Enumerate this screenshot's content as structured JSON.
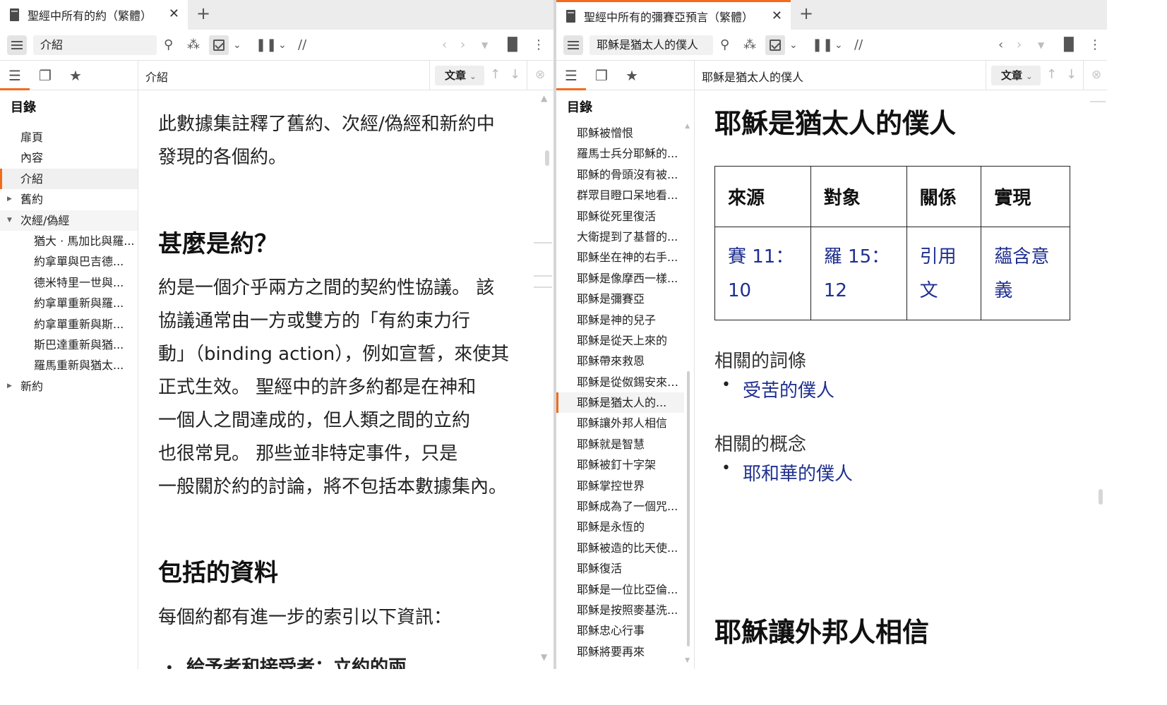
{
  "left": {
    "tab_title": "聖經中所有的約（繁體）",
    "toolbar_input": "介紹",
    "content_header_title": "介紹",
    "view_select": "文章",
    "toc_heading": "目錄",
    "toc": [
      {
        "label": "扉頁",
        "level": 0
      },
      {
        "label": "內容",
        "level": 0
      },
      {
        "label": "介紹",
        "level": 0,
        "selected": true
      },
      {
        "label": "舊約",
        "level": 0,
        "collapsed": true
      },
      {
        "label": "次經/偽經",
        "level": 0,
        "expanded": true
      },
      {
        "label": "猶大 · 馬加比與羅...",
        "level": 1
      },
      {
        "label": "約拿單與巴吉德...",
        "level": 1
      },
      {
        "label": "德米特里一世與...",
        "level": 1
      },
      {
        "label": "約拿單重新與羅...",
        "level": 1
      },
      {
        "label": "約拿單重新與斯...",
        "level": 1
      },
      {
        "label": "斯巴達重新與猶...",
        "level": 1
      },
      {
        "label": "羅馬重新與猶太...",
        "level": 1
      },
      {
        "label": "新約",
        "level": 0,
        "collapsed": true
      }
    ],
    "content": {
      "intro_lines": [
        "此數據集註釋了舊約、次經/偽經和新約中",
        "發現的各個約。"
      ],
      "heading1": "甚麼是約？",
      "para_lines": [
        "約是一個介乎兩方之間的契約性協議。 該",
        "協議通常由一方或雙方的「有約束力行",
        "動」（binding action），例如宣誓，來使其",
        "正式生效。 聖經中的許多約都是在神和",
        "一個人之間達成的，但人類之間的立約",
        "也很常見。 那些並非特定事件，只是",
        "一般關於約的討論，將不包括本數據集內。"
      ],
      "heading2": "包括的資料",
      "para2": "每個約都有進一步的索引以下資訊：",
      "bullet_partial": "給予者和接受者：立約的兩"
    }
  },
  "right": {
    "tab_title": "聖經中所有的彌賽亞預言（繁體）",
    "toolbar_input": "耶穌是猶太人的僕人",
    "content_header_title": "耶穌是猶太人的僕人",
    "view_select": "文章",
    "toc_heading": "目錄",
    "toc": [
      {
        "label": "耶穌被憎恨"
      },
      {
        "label": "羅馬士兵分耶穌的..."
      },
      {
        "label": "耶穌的骨頭沒有被..."
      },
      {
        "label": "群眾目瞪口呆地看..."
      },
      {
        "label": "耶穌從死里復活"
      },
      {
        "label": "大衛提到了基督的..."
      },
      {
        "label": "耶穌坐在神的右手..."
      },
      {
        "label": "耶穌是像摩西一樣..."
      },
      {
        "label": "耶穌是彌賽亞"
      },
      {
        "label": "耶穌是神的兒子"
      },
      {
        "label": "耶穌是從天上來的"
      },
      {
        "label": "耶穌帶來救恩"
      },
      {
        "label": "耶穌是從伮錫安來的..."
      },
      {
        "label": "耶穌是猶太人的...",
        "selected": true
      },
      {
        "label": "耶穌讓外邦人相信"
      },
      {
        "label": "耶穌就是智慧"
      },
      {
        "label": "耶穌被釘十字架"
      },
      {
        "label": "耶穌掌控世界"
      },
      {
        "label": "耶穌成為了一個咒..."
      },
      {
        "label": "耶穌是永恆的"
      },
      {
        "label": "耶穌被造的比天使..."
      },
      {
        "label": "耶穌復活"
      },
      {
        "label": "耶穌是一位比亞倫..."
      },
      {
        "label": "耶穌是按照麥基洗..."
      },
      {
        "label": "耶穌忠心行事"
      },
      {
        "label": "耶穌將要再來"
      }
    ],
    "content": {
      "title": "耶穌是猶太人的僕人",
      "table_headers": [
        "來源",
        "對象",
        "關係",
        "實現"
      ],
      "table_row": [
        "賽 11：10",
        "羅 15：12",
        "引用文",
        "蘊含意義"
      ],
      "related_terms_label": "相關的詞條",
      "related_terms": [
        "受苦的僕人"
      ],
      "related_concepts_label": "相關的概念",
      "related_concepts": [
        "耶和華的僕人"
      ],
      "next_heading": "耶穌讓外邦人相信"
    }
  },
  "colors": {
    "accent": "#f26b1d",
    "link": "#1f2f8f"
  }
}
